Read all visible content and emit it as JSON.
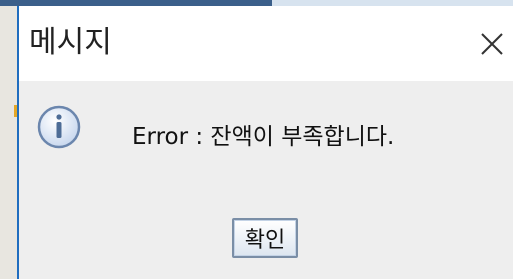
{
  "dialog": {
    "title": "메시지",
    "close_icon": "close-icon",
    "message": "Error : 잔액이 부족합니다.",
    "message_icon": "info-icon",
    "ok_button_label": "확인"
  },
  "colors": {
    "accent_border": "#1f6dbf",
    "body_background": "#eeeeee",
    "icon_fill": "#c9d8ee",
    "icon_stroke": "#6b86ad"
  }
}
